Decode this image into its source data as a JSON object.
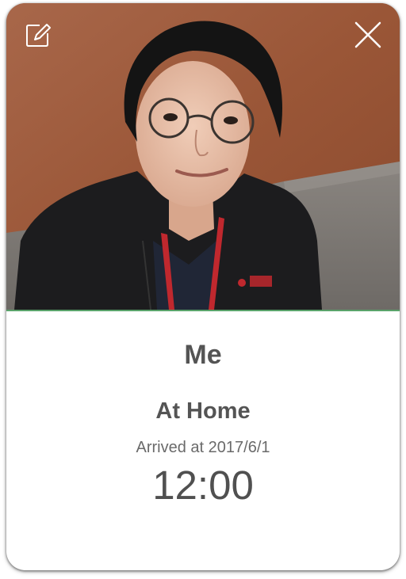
{
  "profile": {
    "name": "Me",
    "location": "At Home",
    "arrived_label": "Arrived at 2017/6/1",
    "time": "12:00"
  },
  "icons": {
    "edit": "edit-pencil-icon",
    "close": "close-icon"
  },
  "colors": {
    "accent_line": "#5aa36a",
    "text": "#545454",
    "background": "#ffffff"
  }
}
